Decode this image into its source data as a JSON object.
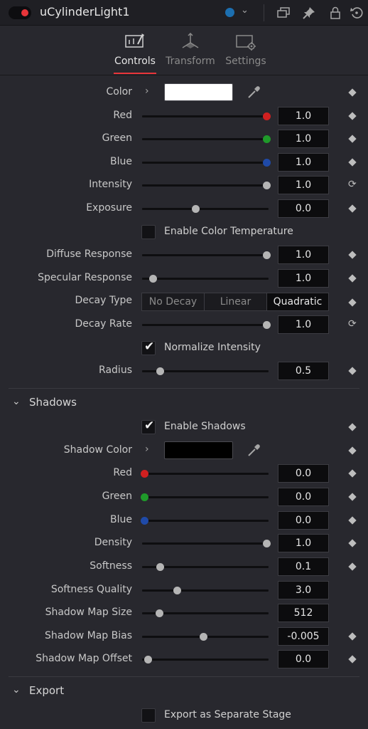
{
  "header": {
    "title": "uCylinderLight1",
    "power_dot_color": "#e8353a",
    "color_dot": "#1c6fb0",
    "icons": [
      "power-toggle",
      "color-dot",
      "chevron-down-icon",
      "versions-icon",
      "pin-icon",
      "lock-icon",
      "reset-icon"
    ]
  },
  "tabs": [
    {
      "label": "Controls",
      "icon": "controls-icon",
      "active": true
    },
    {
      "label": "Transform",
      "icon": "transform-icon",
      "active": false
    },
    {
      "label": "Settings",
      "icon": "settings-icon",
      "active": false
    }
  ],
  "controls": {
    "color": {
      "label": "Color",
      "swatch": "#ffffff"
    },
    "red": {
      "label": "Red",
      "value": "1.0",
      "slider": 1.0,
      "knob_color": "#d02020"
    },
    "green": {
      "label": "Green",
      "value": "1.0",
      "slider": 1.0,
      "knob_color": "#1f9a2a"
    },
    "blue": {
      "label": "Blue",
      "value": "1.0",
      "slider": 1.0,
      "knob_color": "#1f4aa8"
    },
    "intensity": {
      "label": "Intensity",
      "value": "1.0",
      "slider": 1.0
    },
    "exposure": {
      "label": "Exposure",
      "value": "0.0",
      "slider": 0.42
    },
    "enable_color_temp": {
      "label": "Enable Color Temperature",
      "checked": false
    },
    "diffuse_response": {
      "label": "Diffuse Response",
      "value": "1.0",
      "slider": 1.0
    },
    "specular_response": {
      "label": "Specular Response",
      "value": "1.0",
      "slider": 0.07
    },
    "decay_type": {
      "label": "Decay Type",
      "options": [
        "No Decay",
        "Linear",
        "Quadratic"
      ],
      "selected": "Quadratic"
    },
    "decay_rate": {
      "label": "Decay Rate",
      "value": "1.0",
      "slider": 1.0
    },
    "normalize_intensity": {
      "label": "Normalize Intensity",
      "checked": true
    },
    "radius": {
      "label": "Radius",
      "value": "0.5",
      "slider": 0.13
    }
  },
  "shadows": {
    "section_title": "Shadows",
    "enable_shadows": {
      "label": "Enable Shadows",
      "checked": true
    },
    "shadow_color": {
      "label": "Shadow Color",
      "swatch": "#000000"
    },
    "red": {
      "label": "Red",
      "value": "0.0",
      "slider": 0.0,
      "knob_color": "#d02020"
    },
    "green": {
      "label": "Green",
      "value": "0.0",
      "slider": 0.0,
      "knob_color": "#1f9a2a"
    },
    "blue": {
      "label": "Blue",
      "value": "0.0",
      "slider": 0.0,
      "knob_color": "#1f4aa8"
    },
    "density": {
      "label": "Density",
      "value": "1.0",
      "slider": 1.0
    },
    "softness": {
      "label": "Softness",
      "value": "0.1",
      "slider": 0.13
    },
    "softness_quality": {
      "label": "Softness Quality",
      "value": "3.0",
      "slider": 0.27
    },
    "shadow_map_size": {
      "label": "Shadow Map Size",
      "value": "512",
      "slider": 0.12
    },
    "shadow_map_bias": {
      "label": "Shadow Map Bias",
      "value": "-0.005",
      "slider": 0.48
    },
    "shadow_map_offset": {
      "label": "Shadow Map Offset",
      "value": "0.0",
      "slider": 0.03
    }
  },
  "export": {
    "section_title": "Export",
    "export_separate_stage": {
      "label": "Export as Separate Stage",
      "checked": false
    }
  }
}
